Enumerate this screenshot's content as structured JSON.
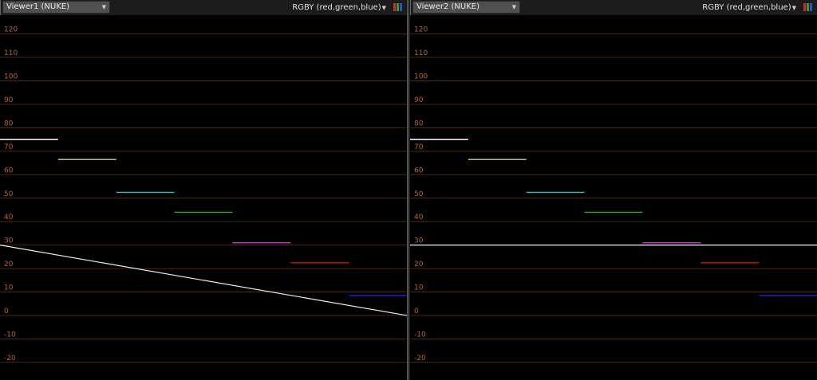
{
  "viewers": [
    {
      "title": "Viewer1 (NUKE)",
      "channels": "RGBY (red,green,blue)",
      "guide_line": {
        "type": "diagonal",
        "start_value": 30,
        "end_value": 0
      }
    },
    {
      "title": "Viewer2 (NUKE)",
      "channels": "RGBY (red,green,blue)",
      "guide_line": {
        "type": "horizontal",
        "start_value": 30,
        "end_value": 30
      }
    }
  ],
  "axis": {
    "ticks": [
      "120",
      "110",
      "100",
      "90",
      "80",
      "70",
      "60",
      "50",
      "40",
      "30",
      "20",
      "10",
      "0",
      "-10",
      "-20"
    ]
  },
  "colors": {
    "grid": "#4a2a12",
    "tick_text": "#b8672a",
    "guide": "#f0f0f0",
    "bars": [
      "#ffffff",
      "#c8d890",
      "#30c0c0",
      "#20b030",
      "#d030d0",
      "#c01010",
      "#2020e0"
    ]
  },
  "bar_values": [
    75,
    66.5,
    52.5,
    44,
    31,
    22.5,
    8.5
  ],
  "icons": {
    "channel_button": "rgb-bars-icon",
    "dropdown": "chevron-down-icon"
  }
}
